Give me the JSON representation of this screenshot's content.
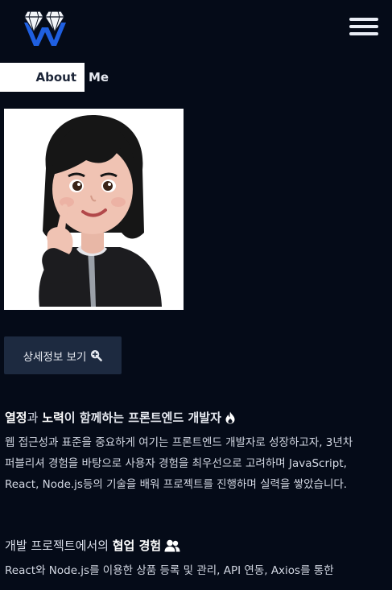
{
  "header": {
    "logo_icon": "diamond-w-logo",
    "menu_icon": "hamburger-menu-icon"
  },
  "section": {
    "title_left": "About",
    "title_right": "Me"
  },
  "profile": {
    "avatar_icon": "memoji-avatar-finger-heart"
  },
  "detail_button": {
    "label": "상세정보 보기",
    "icon": "magnifier-plus-icon"
  },
  "intro": {
    "heading_part1": "열정",
    "heading_part2": "과 ",
    "heading_part3": "노력",
    "heading_part4": "이 함께하는 프론트엔드 개발자",
    "heading_icon": "fire-icon",
    "lines": [
      "웹 접근성과 표준을 중요하게 여기는 프론트엔드 개발자로 성장하고자, 3년차",
      "퍼블리셔 경험을 바탕으로 사용자 경험을 최우선으로 고려하며 JavaScript,",
      "React, Node.js등의 기술을 배워 프로젝트를 진행하며 실력을 쌓았습니다."
    ]
  },
  "collab": {
    "heading_part1": "개발 프로젝트에서의 ",
    "heading_part2": "협업 경험",
    "heading_icon": "users-icon",
    "lines": [
      "React와 Node.js를 이용한 상품 등록 및 관리, API 연동, Axios를 통한"
    ]
  },
  "colors": {
    "background": "#050b18",
    "button_bg": "#1d2a40",
    "logo_blue": "#1f5fe0"
  }
}
